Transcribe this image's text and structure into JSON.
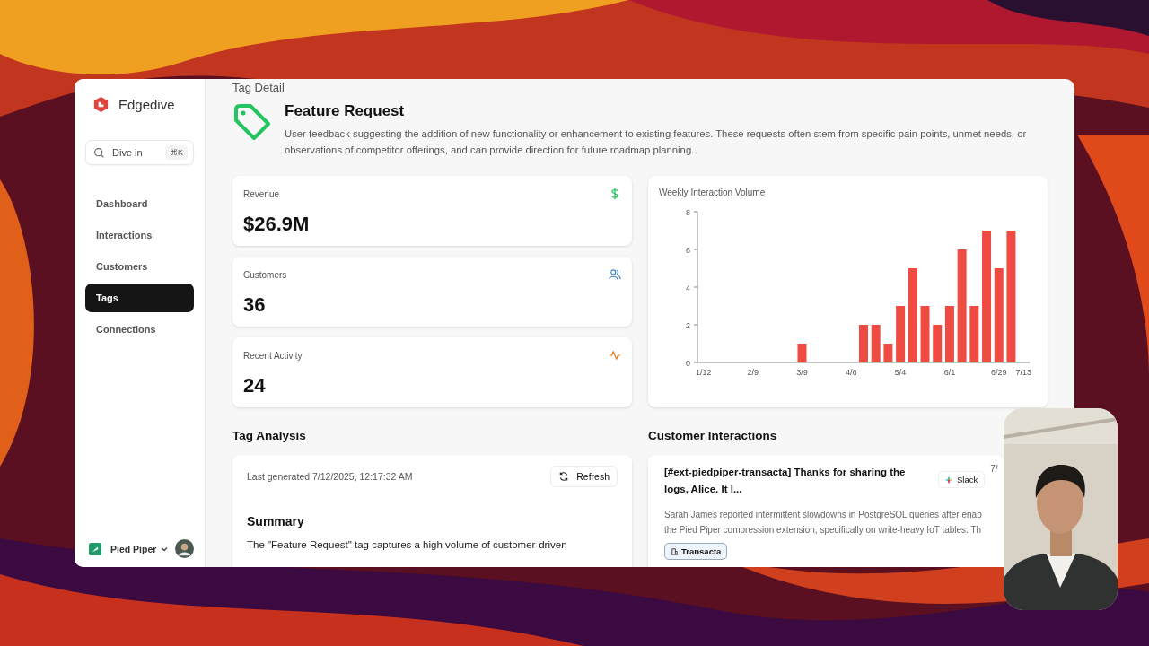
{
  "sidebar": {
    "brand": "Edgedive",
    "search": {
      "placeholder": "Dive in",
      "shortcut": "⌘K"
    },
    "items": [
      {
        "label": "Dashboard",
        "selected": false
      },
      {
        "label": "Interactions",
        "selected": false
      },
      {
        "label": "Customers",
        "selected": false
      },
      {
        "label": "Tags",
        "selected": true
      },
      {
        "label": "Connections",
        "selected": false
      }
    ],
    "workspace": "Pied Piper"
  },
  "page": {
    "breadcrumb": "Tag Detail",
    "title": "Feature Request",
    "description": "User feedback suggesting the addition of new functionality or enhancement to existing features. These requests often stem from specific pain points, unmet needs, or observations of competitor offerings, and can provide direction for future roadmap planning."
  },
  "stats": [
    {
      "label": "Revenue",
      "value": "$26.9M",
      "kind": "dollar"
    },
    {
      "label": "Customers",
      "value": "36",
      "kind": "people"
    },
    {
      "label": "Recent Activity",
      "value": "24",
      "kind": "activity"
    }
  ],
  "volume": {
    "chart_data": {
      "type": "bar",
      "title": "Weekly Interaction Volume",
      "categories": [
        "1/12",
        null,
        null,
        null,
        "2/9",
        null,
        null,
        null,
        "3/9",
        null,
        null,
        null,
        "4/6",
        null,
        null,
        null,
        "5/4",
        null,
        null,
        null,
        "6/1",
        null,
        null,
        null,
        "6/29",
        null,
        "7/13"
      ],
      "series": [
        {
          "color": "#ef4b43",
          "values": [
            0,
            0,
            0,
            0,
            0,
            0,
            0,
            0,
            1,
            0,
            0,
            0,
            0,
            2,
            2,
            1,
            3,
            5,
            3,
            2,
            3,
            6,
            3,
            7,
            5,
            7,
            0
          ]
        }
      ],
      "ylim": [
        0,
        8
      ],
      "yticks": [
        0,
        2,
        4,
        6,
        8
      ]
    }
  },
  "tag_analysis": {
    "heading": "Tag Analysis",
    "last_generated": "Last generated 7/12/2025, 12:17:32 AM",
    "refresh": "Refresh",
    "summary_heading": "Summary",
    "summary": "The \"Feature Request\" tag captures a high volume of customer-driven"
  },
  "customer_interactions": {
    "heading": "Customer Interactions",
    "items": [
      {
        "title": "[#ext-piedpiper-transacta] Thanks for sharing the logs, Alice. It l...",
        "source": "Slack",
        "date": "7/",
        "summary_lines": [
          "Sarah James reported intermittent slowdowns in PostgreSQL queries after enab",
          "the Pied Piper compression extension, specifically on write-heavy IoT tables. Th"
        ],
        "tags": [
          "Transacta"
        ]
      }
    ]
  }
}
